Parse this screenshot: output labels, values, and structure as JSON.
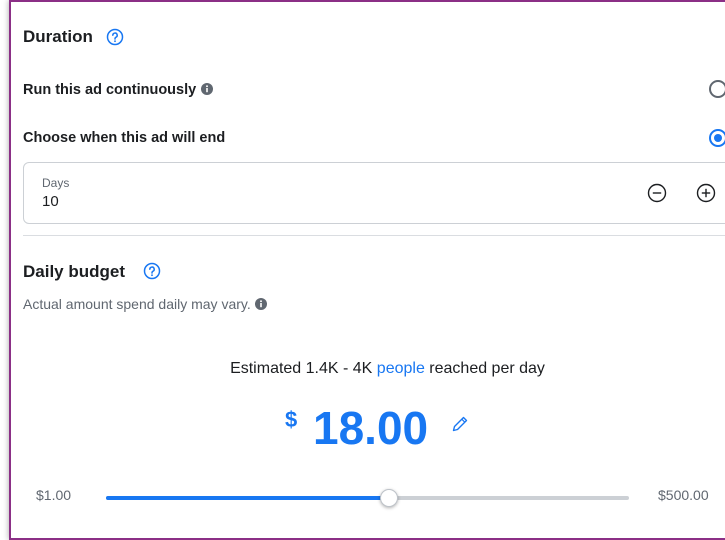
{
  "duration": {
    "title": "Duration",
    "option_continuous": "Run this ad continuously",
    "option_end": "Choose when this ad will end",
    "selected": "end",
    "days_label": "Days",
    "days_value": "10"
  },
  "budget": {
    "title": "Daily budget",
    "subtitle": "Actual amount spend daily may vary.",
    "estimate_prefix": "Estimated 1.4K - 4K ",
    "estimate_link": "people",
    "estimate_suffix": " reached per day",
    "currency_symbol": "$",
    "amount": "18.00",
    "slider_min_label": "$1.00",
    "slider_max_label": "$500.00",
    "slider_fraction": 0.542
  },
  "colors": {
    "accent": "#1877f2",
    "frame_border": "#8b2f86"
  },
  "icons": [
    "help-circle-icon",
    "info-icon",
    "minus-circle-icon",
    "plus-circle-icon",
    "pencil-icon"
  ]
}
